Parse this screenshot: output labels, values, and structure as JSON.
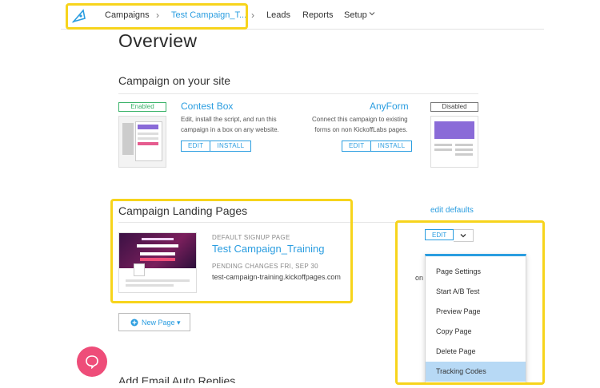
{
  "nav": {
    "breadcrumb_campaigns": "Campaigns",
    "breadcrumb_current": "Test Campaign_T...",
    "leads": "Leads",
    "reports": "Reports",
    "setup": "Setup"
  },
  "page": {
    "title": "Overview"
  },
  "campaign_on_site": {
    "heading": "Campaign on your site",
    "contest_box": {
      "status": "Enabled",
      "title": "Contest Box",
      "desc_line1": "Edit, install the script, and run this",
      "desc_line2": "campaign in a box on any website.",
      "edit_label": "EDIT",
      "install_label": "INSTALL"
    },
    "anyform": {
      "status": "Disabled",
      "title": "AnyForm",
      "desc_line1": "Connect this campaign to existing",
      "desc_line2": "forms on non KickoffLabs pages.",
      "edit_label": "EDIT",
      "install_label": "INSTALL"
    }
  },
  "landing_pages": {
    "heading": "Campaign Landing Pages",
    "edit_defaults": "edit defaults",
    "page_type": "DEFAULT SIGNUP PAGE",
    "page_name": "Test Campaign_Training",
    "pending": "PENDING CHANGES FRI, SEP 30",
    "url": "test-campaign-training.kickoffpages.com",
    "edit_label": "EDIT",
    "partial_text": "on",
    "new_page_label": "New Page ▾"
  },
  "dropdown": {
    "items": [
      "Page Settings",
      "Start A/B Test",
      "Preview Page",
      "Copy Page",
      "Delete Page",
      "Tracking Codes"
    ],
    "highlighted": "Tracking Codes"
  },
  "email": {
    "heading": "Add Email Auto Replies"
  },
  "colors": {
    "accent": "#2a9de0",
    "highlight": "#f7d41c",
    "chat": "#ee4d79",
    "enabled": "#3bb36a"
  },
  "icons": [
    "rocket-logo-icon",
    "chevron-right-icon",
    "chevron-down-icon",
    "plus-circle-icon",
    "chat-bubble-icon"
  ]
}
